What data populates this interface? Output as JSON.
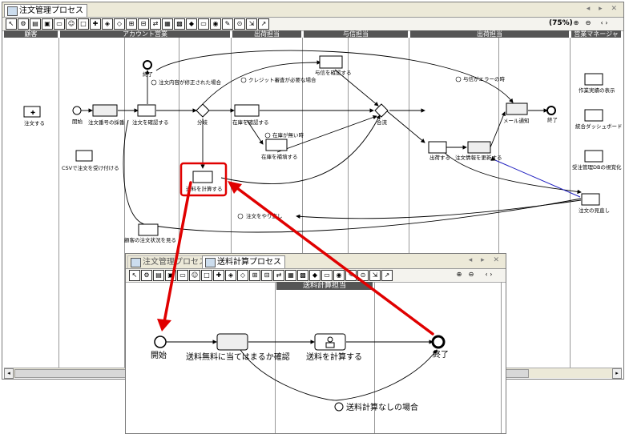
{
  "main_window": {
    "tab_label": "注文管理プロセス",
    "zoom": "(75%)",
    "lanes": [
      "顧客",
      "アカウント営業",
      "出荷担当",
      "与信担当",
      "出荷担当",
      "営業マネージャ"
    ],
    "nodes": {
      "order": "注文する",
      "csv": "CSVで注文を受け付ける",
      "start": "開始",
      "assign": "注文番号の採番",
      "end_top": "終了",
      "confirm": "注文を確認する",
      "branch": "分岐",
      "stock_check": "在庫を確認する",
      "stock_add": "在庫を補填する",
      "credit": "与信を確認する",
      "merge": "合流",
      "ship": "出荷する",
      "update_status": "注文情報を更新する",
      "mail": "メール通知",
      "end_right": "終了",
      "shipping_calc": "送料を計算する",
      "history": "作業実績の表示",
      "dashboard": "統合ダッシュボード",
      "visualize": "受注管理DBの視覚化",
      "review": "注文の見直し",
      "customer_view": "顧客の注文状況を見る"
    },
    "conditions": {
      "content_changed": "注文内容が修正された場合",
      "credit_needed": "クレジット審査が必要な場合",
      "no_stock": "在庫が無い時",
      "error": "与信がエラーの時",
      "redo": "注文をやり直し"
    }
  },
  "sub_window": {
    "tab_inactive": "注文管理プロセス",
    "tab_active": "送料計算プロセス",
    "lane_title": "送料計算担当",
    "nodes": {
      "start": "開始",
      "check_free": "送料無料に当てはまるか確認",
      "calc": "送料を計算する",
      "end": "終了"
    },
    "condition": "送料計算なしの場合"
  }
}
